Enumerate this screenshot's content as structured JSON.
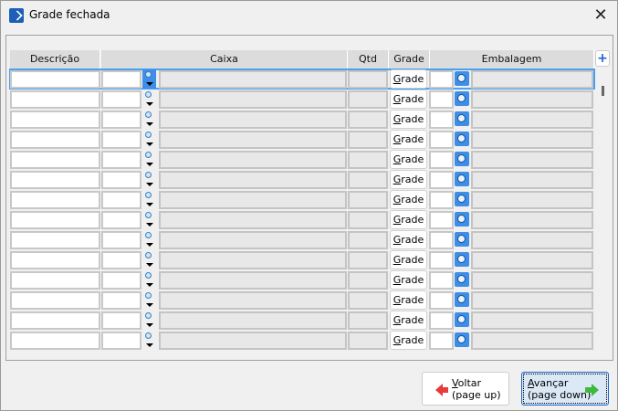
{
  "window": {
    "title": "Grade fechada"
  },
  "grid": {
    "columns": [
      "Descrição",
      "Caixa",
      "Qtd",
      "Grade",
      "Embalagem"
    ],
    "grade_button_label": "Grade",
    "row_count": 14
  },
  "buttons": {
    "back": {
      "accel": "V",
      "rest": "oltar",
      "line2": "(page up)"
    },
    "next": {
      "accel": "A",
      "rest": "vançar",
      "line2": "(page down)"
    }
  }
}
